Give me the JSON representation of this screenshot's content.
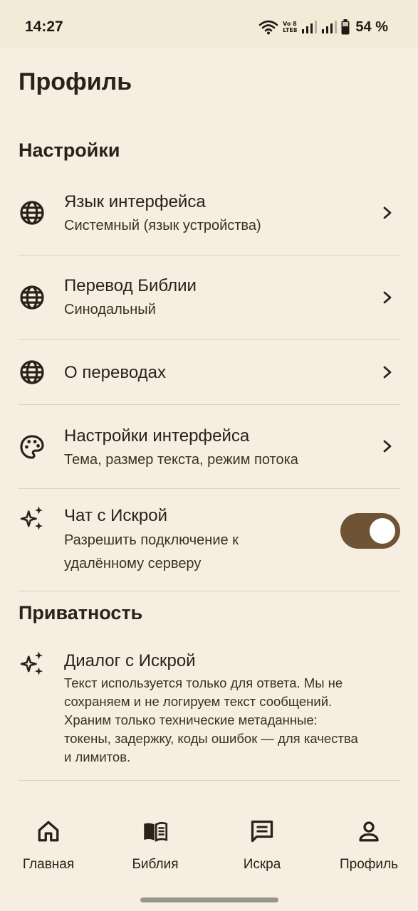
{
  "status_bar": {
    "time": "14:27",
    "network_label_top": "Vo 8",
    "network_label_bottom": "LTE8",
    "battery": "54 %"
  },
  "page_title": "Профиль",
  "settings": {
    "section_title": "Настройки",
    "items": [
      {
        "title": "Язык интерфейса",
        "subtitle": "Системный (язык устройства)",
        "icon": "globe-icon"
      },
      {
        "title": "Перевод Библии",
        "subtitle": "Синодальный",
        "icon": "globe-icon"
      },
      {
        "title": "О переводах",
        "subtitle": "",
        "icon": "globe-icon"
      },
      {
        "title": "Настройки интерфейса",
        "subtitle": "Тема, размер текста, режим потока",
        "icon": "palette-icon"
      }
    ],
    "chat": {
      "title": "Чат с Искрой",
      "subtitle_line1": "Разрешить подключение к",
      "subtitle_line2": "удалённому серверу",
      "icon": "sparkles-icon",
      "enabled": true
    }
  },
  "privacy": {
    "section_title": "Приватность",
    "item": {
      "title": "Диалог с Искрой",
      "icon": "sparkles-icon",
      "text_lines": [
        "Текст используется только для ответа. Мы не",
        "сохраняем и не логируем текст сообщений.",
        "Храним только технические метаданные:",
        "токены, задержку, коды ошибок — для качества",
        "и лимитов."
      ]
    }
  },
  "bottom_nav": [
    {
      "label": "Главная",
      "icon": "home-icon"
    },
    {
      "label": "Библия",
      "icon": "book-icon"
    },
    {
      "label": "Искра",
      "icon": "chat-icon"
    },
    {
      "label": "Профиль",
      "icon": "profile-icon",
      "active": true
    }
  ],
  "colors": {
    "background": "#f6eee0",
    "toggle_on": "#6e5434",
    "text": "#2a2218"
  }
}
